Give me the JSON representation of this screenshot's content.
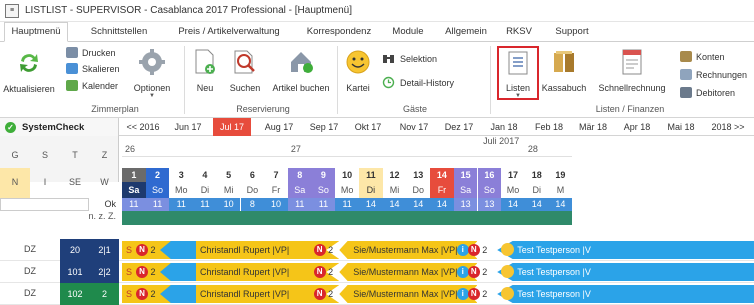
{
  "window": {
    "title": "LISTLIST - SUPERVISOR - Casablanca 2017 Professional - [Hauptmenü]"
  },
  "tabs": [
    {
      "label": "Hauptmenü",
      "active": true
    },
    {
      "label": "Schnittstellen"
    },
    {
      "label": "Preis / Artikelverwaltung"
    },
    {
      "label": "Korrespondenz"
    },
    {
      "label": "Module"
    },
    {
      "label": "Allgemein"
    },
    {
      "label": "RKSV"
    },
    {
      "label": "Support"
    }
  ],
  "ribbon": {
    "aktualisieren": "Aktualisieren",
    "drucken": "Drucken",
    "skalieren": "Skalieren",
    "kalender": "Kalender",
    "optionen": "Optionen",
    "neu": "Neu",
    "suchen": "Suchen",
    "artikel_buchen": "Artikel buchen",
    "kartei": "Kartei",
    "selektion": "Selektion",
    "detail_history": "Detail-History",
    "listen": "Listen",
    "kassabuch": "Kassabuch",
    "schnellrechnung": "Schnellrechnung",
    "konten": "Konten",
    "rechnungen": "Rechnungen",
    "debitoren": "Debitoren",
    "groups": {
      "zimmerplan": "Zimmerplan",
      "reservierung": "Reservierung",
      "gaeste": "Gäste",
      "listen_finanzen": "Listen / Finanzen"
    }
  },
  "nav": {
    "systemcheck": "SystemCheck",
    "months": [
      "<< 2016",
      "Jun 17",
      "Jul 17",
      "Aug 17",
      "Sep 17",
      "Okt 17",
      "Nov 17",
      "Dez 17",
      "Jan 18",
      "Feb 18",
      "Mär 18",
      "Apr 18",
      "Mai 18",
      "2018 >>"
    ],
    "current_month": "Jul 17"
  },
  "left_header": {
    "cols": [
      "G",
      "S",
      "T",
      "Z"
    ],
    "row2": [
      "N",
      "I",
      "SE",
      "W"
    ],
    "ok": "Ok",
    "nz": "n. z. Z."
  },
  "calendar": {
    "month_label": "Juli 2017",
    "weeks": [
      "26",
      "27",
      "28"
    ],
    "days": [
      {
        "d": "1",
        "w": "Sa",
        "n": "11",
        "type": "sat"
      },
      {
        "d": "2",
        "w": "So",
        "n": "11",
        "type": "sun"
      },
      {
        "d": "3",
        "w": "Mo",
        "n": "11",
        "type": "wd"
      },
      {
        "d": "4",
        "w": "Di",
        "n": "11",
        "type": "wd"
      },
      {
        "d": "5",
        "w": "Mi",
        "n": "10",
        "type": "wd"
      },
      {
        "d": "6",
        "w": "Do",
        "n": "8",
        "type": "wd"
      },
      {
        "d": "7",
        "w": "Fr",
        "n": "10",
        "type": "wd"
      },
      {
        "d": "8",
        "w": "Sa",
        "n": "11",
        "type": "we"
      },
      {
        "d": "9",
        "w": "So",
        "n": "11",
        "type": "we"
      },
      {
        "d": "10",
        "w": "Mo",
        "n": "11",
        "type": "wd"
      },
      {
        "d": "11",
        "w": "Di",
        "n": "14",
        "type": "hl"
      },
      {
        "d": "12",
        "w": "Mi",
        "n": "14",
        "type": "wd"
      },
      {
        "d": "13",
        "w": "Do",
        "n": "14",
        "type": "wd"
      },
      {
        "d": "14",
        "w": "Fr",
        "n": "14",
        "type": "today"
      },
      {
        "d": "15",
        "w": "Sa",
        "n": "13",
        "type": "we"
      },
      {
        "d": "16",
        "w": "So",
        "n": "13",
        "type": "we"
      },
      {
        "d": "17",
        "w": "Mo",
        "n": "14",
        "type": "wd"
      },
      {
        "d": "18",
        "w": "Di",
        "n": "14",
        "type": "wd"
      },
      {
        "d": "19",
        "w": "M",
        "n": "14",
        "type": "wd"
      }
    ]
  },
  "rooms": [
    {
      "type": "DZ",
      "num": "20",
      "cap": "2|1",
      "color": "#1f3f7a"
    },
    {
      "type": "DZ",
      "num": "101",
      "cap": "2|2",
      "color": "#1f3f7a"
    },
    {
      "type": "DZ",
      "num": "102",
      "cap": "2",
      "color": "#1f8a4c"
    }
  ],
  "bookings": {
    "s_label": "S",
    "n_label": "N",
    "n_count": "2",
    "guest1": "Christandl Rupert |VP|",
    "guest2": "Sie/Mustermann Max |VP|",
    "guest3": "Test Testperson |V",
    "i_label": "i"
  },
  "colors": {
    "accent_red": "#e74c3c",
    "booking_yellow": "#f5c518",
    "booking_blue": "#2ba3e8",
    "week_blue": "#5b63c8",
    "weekend_purple": "#8b7fd8"
  }
}
